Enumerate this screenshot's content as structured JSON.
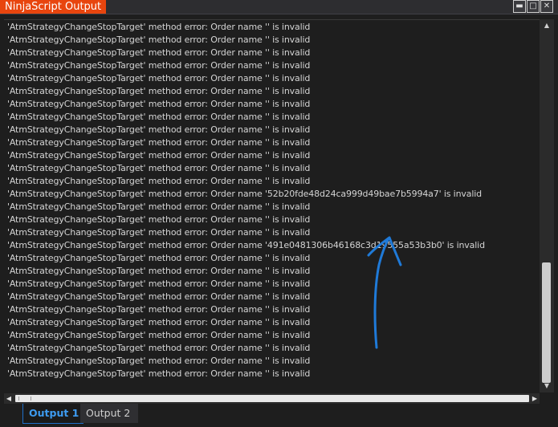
{
  "window": {
    "title": "NinjaScript Output",
    "minimize_icon": "minimize-icon",
    "maximize_icon": "maximize-icon",
    "close_icon": "close-icon",
    "accent_color": "#e8450e"
  },
  "log": {
    "lines": [
      "'AtmStrategyChangeStopTarget' method error: Order name '' is invalid",
      "'AtmStrategyChangeStopTarget' method error: Order name '' is invalid",
      "'AtmStrategyChangeStopTarget' method error: Order name '' is invalid",
      "'AtmStrategyChangeStopTarget' method error: Order name '' is invalid",
      "'AtmStrategyChangeStopTarget' method error: Order name '' is invalid",
      "'AtmStrategyChangeStopTarget' method error: Order name '' is invalid",
      "'AtmStrategyChangeStopTarget' method error: Order name '' is invalid",
      "'AtmStrategyChangeStopTarget' method error: Order name '' is invalid",
      "'AtmStrategyChangeStopTarget' method error: Order name '' is invalid",
      "'AtmStrategyChangeStopTarget' method error: Order name '' is invalid",
      "'AtmStrategyChangeStopTarget' method error: Order name '' is invalid",
      "'AtmStrategyChangeStopTarget' method error: Order name '' is invalid",
      "'AtmStrategyChangeStopTarget' method error: Order name '' is invalid",
      "'AtmStrategyChangeStopTarget' method error: Order name '52b20fde48d24ca999d49bae7b5994a7' is invalid",
      "'AtmStrategyChangeStopTarget' method error: Order name '' is invalid",
      "'AtmStrategyChangeStopTarget' method error: Order name '' is invalid",
      "'AtmStrategyChangeStopTarget' method error: Order name '' is invalid",
      "'AtmStrategyChangeStopTarget' method error: Order name '491e0481306b46168c3d19555a53b3b0' is invalid",
      "'AtmStrategyChangeStopTarget' method error: Order name '' is invalid",
      "'AtmStrategyChangeStopTarget' method error: Order name '' is invalid",
      "'AtmStrategyChangeStopTarget' method error: Order name '' is invalid",
      "'AtmStrategyChangeStopTarget' method error: Order name '' is invalid",
      "'AtmStrategyChangeStopTarget' method error: Order name '' is invalid",
      "'AtmStrategyChangeStopTarget' method error: Order name '' is invalid",
      "'AtmStrategyChangeStopTarget' method error: Order name '' is invalid",
      "'AtmStrategyChangeStopTarget' method error: Order name '' is invalid",
      "'AtmStrategyChangeStopTarget' method error: Order name '' is invalid",
      "'AtmStrategyChangeStopTarget' method error: Order name '' is invalid",
      "'AtmStrategyChangeStopTarget' method error: Order name '' is invalid",
      "'AtmStrategyChangeStopTarget' method error: Order name '' is invalid"
    ]
  },
  "tabs": [
    {
      "label": "Output 1",
      "active": true
    },
    {
      "label": "Output 2",
      "active": false
    }
  ],
  "annotation": {
    "color": "#1f7ad8"
  }
}
